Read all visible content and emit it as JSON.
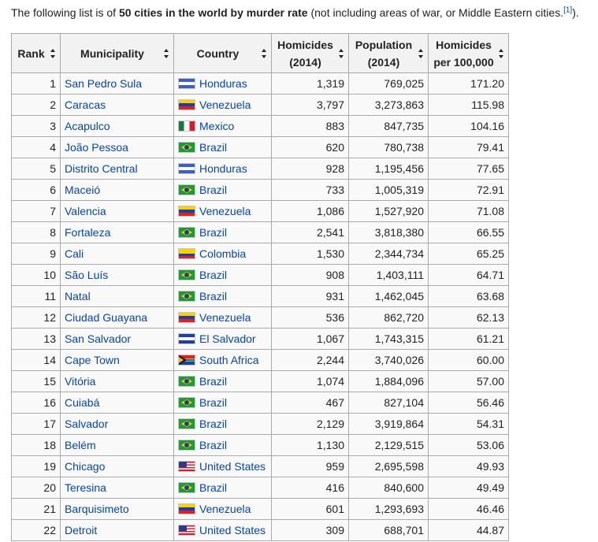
{
  "intro": {
    "prefix": "The following list is of ",
    "bold": "50 cities in the world by murder rate",
    "suffix": " (not including areas of war, or Middle Eastern cities.",
    "ref": "[1]",
    "end": ")."
  },
  "table": {
    "headers": {
      "rank": "Rank",
      "municipality": "Municipality",
      "country": "Country",
      "homicides_line1": "Homicides",
      "homicides_line2": "(2014)",
      "population_line1": "Population",
      "population_line2": "(2014)",
      "rate_line1": "Homicides",
      "rate_line2": "per 100,000"
    },
    "rows": [
      {
        "rank": "1",
        "city": "San Pedro Sula",
        "country": "Honduras",
        "flag": "honduras",
        "homicides": "1,319",
        "population": "769,025",
        "rate": "171.20"
      },
      {
        "rank": "2",
        "city": "Caracas",
        "country": "Venezuela",
        "flag": "venezuela",
        "homicides": "3,797",
        "population": "3,273,863",
        "rate": "115.98"
      },
      {
        "rank": "3",
        "city": "Acapulco",
        "country": "Mexico",
        "flag": "mexico",
        "homicides": "883",
        "population": "847,735",
        "rate": "104.16"
      },
      {
        "rank": "4",
        "city": "João Pessoa",
        "country": "Brazil",
        "flag": "brazil",
        "homicides": "620",
        "population": "780,738",
        "rate": "79.41"
      },
      {
        "rank": "5",
        "city": "Distrito Central",
        "country": "Honduras",
        "flag": "honduras",
        "homicides": "928",
        "population": "1,195,456",
        "rate": "77.65"
      },
      {
        "rank": "6",
        "city": "Maceió",
        "country": "Brazil",
        "flag": "brazil",
        "homicides": "733",
        "population": "1,005,319",
        "rate": "72.91"
      },
      {
        "rank": "7",
        "city": "Valencia",
        "country": "Venezuela",
        "flag": "venezuela",
        "homicides": "1,086",
        "population": "1,527,920",
        "rate": "71.08"
      },
      {
        "rank": "8",
        "city": "Fortaleza",
        "country": "Brazil",
        "flag": "brazil",
        "homicides": "2,541",
        "population": "3,818,380",
        "rate": "66.55"
      },
      {
        "rank": "9",
        "city": "Cali",
        "country": "Colombia",
        "flag": "colombia",
        "homicides": "1,530",
        "population": "2,344,734",
        "rate": "65.25"
      },
      {
        "rank": "10",
        "city": "São Luís",
        "country": "Brazil",
        "flag": "brazil",
        "homicides": "908",
        "population": "1,403,111",
        "rate": "64.71"
      },
      {
        "rank": "11",
        "city": "Natal",
        "country": "Brazil",
        "flag": "brazil",
        "homicides": "931",
        "population": "1,462,045",
        "rate": "63.68"
      },
      {
        "rank": "12",
        "city": "Ciudad Guayana",
        "country": "Venezuela",
        "flag": "venezuela",
        "homicides": "536",
        "population": "862,720",
        "rate": "62.13"
      },
      {
        "rank": "13",
        "city": "San Salvador",
        "country": "El Salvador",
        "flag": "elsalvador",
        "homicides": "1,067",
        "population": "1,743,315",
        "rate": "61.21"
      },
      {
        "rank": "14",
        "city": "Cape Town",
        "country": "South Africa",
        "flag": "southafrica",
        "homicides": "2,244",
        "population": "3,740,026",
        "rate": "60.00"
      },
      {
        "rank": "15",
        "city": "Vitória",
        "country": "Brazil",
        "flag": "brazil",
        "homicides": "1,074",
        "population": "1,884,096",
        "rate": "57.00"
      },
      {
        "rank": "16",
        "city": "Cuiabá",
        "country": "Brazil",
        "flag": "brazil",
        "homicides": "467",
        "population": "827,104",
        "rate": "56.46"
      },
      {
        "rank": "17",
        "city": "Salvador",
        "country": "Brazil",
        "flag": "brazil",
        "homicides": "2,129",
        "population": "3,919,864",
        "rate": "54.31"
      },
      {
        "rank": "18",
        "city": "Belém",
        "country": "Brazil",
        "flag": "brazil",
        "homicides": "1,130",
        "population": "2,129,515",
        "rate": "53.06"
      },
      {
        "rank": "19",
        "city": "Chicago",
        "country": "United States",
        "flag": "usa",
        "homicides": "959",
        "population": "2,695,598",
        "rate": "49.93"
      },
      {
        "rank": "20",
        "city": "Teresina",
        "country": "Brazil",
        "flag": "brazil",
        "homicides": "416",
        "population": "840,600",
        "rate": "49.49"
      },
      {
        "rank": "21",
        "city": "Barquisimeto",
        "country": "Venezuela",
        "flag": "venezuela",
        "homicides": "601",
        "population": "1,293,693",
        "rate": "46.46"
      },
      {
        "rank": "22",
        "city": "Detroit",
        "country": "United States",
        "flag": "usa",
        "homicides": "309",
        "population": "688,701",
        "rate": "44.87"
      }
    ]
  },
  "colors": {
    "link": "#0645ad",
    "border": "#aaaaaa",
    "header_bg": "#f2f2f2",
    "cell_bg": "#f9f9f9"
  }
}
